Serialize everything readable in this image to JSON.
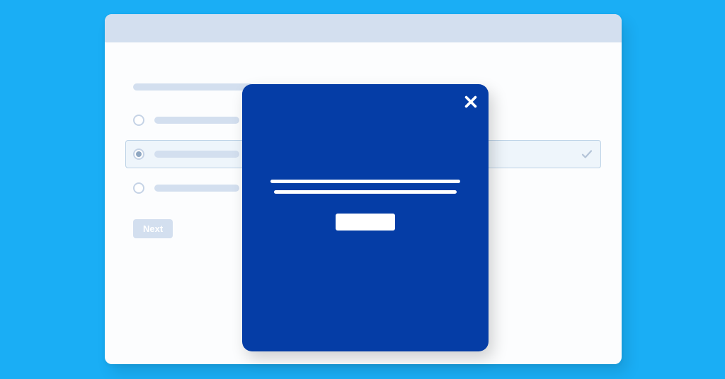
{
  "form": {
    "heading_placeholder": "",
    "options": [
      {
        "label_placeholder": "",
        "selected": false
      },
      {
        "label_placeholder": "",
        "selected": true
      },
      {
        "label_placeholder": "",
        "selected": false
      }
    ],
    "next_button_label": "Next"
  },
  "modal": {
    "close_label": "Close",
    "line1_placeholder": "",
    "line2_placeholder": "",
    "primary_button_label": ""
  },
  "colors": {
    "page_bg": "#1aaef5",
    "window_bg": "#fcfdfe",
    "titlebar_bg": "#d3dfef",
    "placeholder": "#d3dfef",
    "selected_row_bg": "#eef5fb",
    "selected_row_border": "#bcd2e6",
    "modal_bg": "#053da6"
  }
}
